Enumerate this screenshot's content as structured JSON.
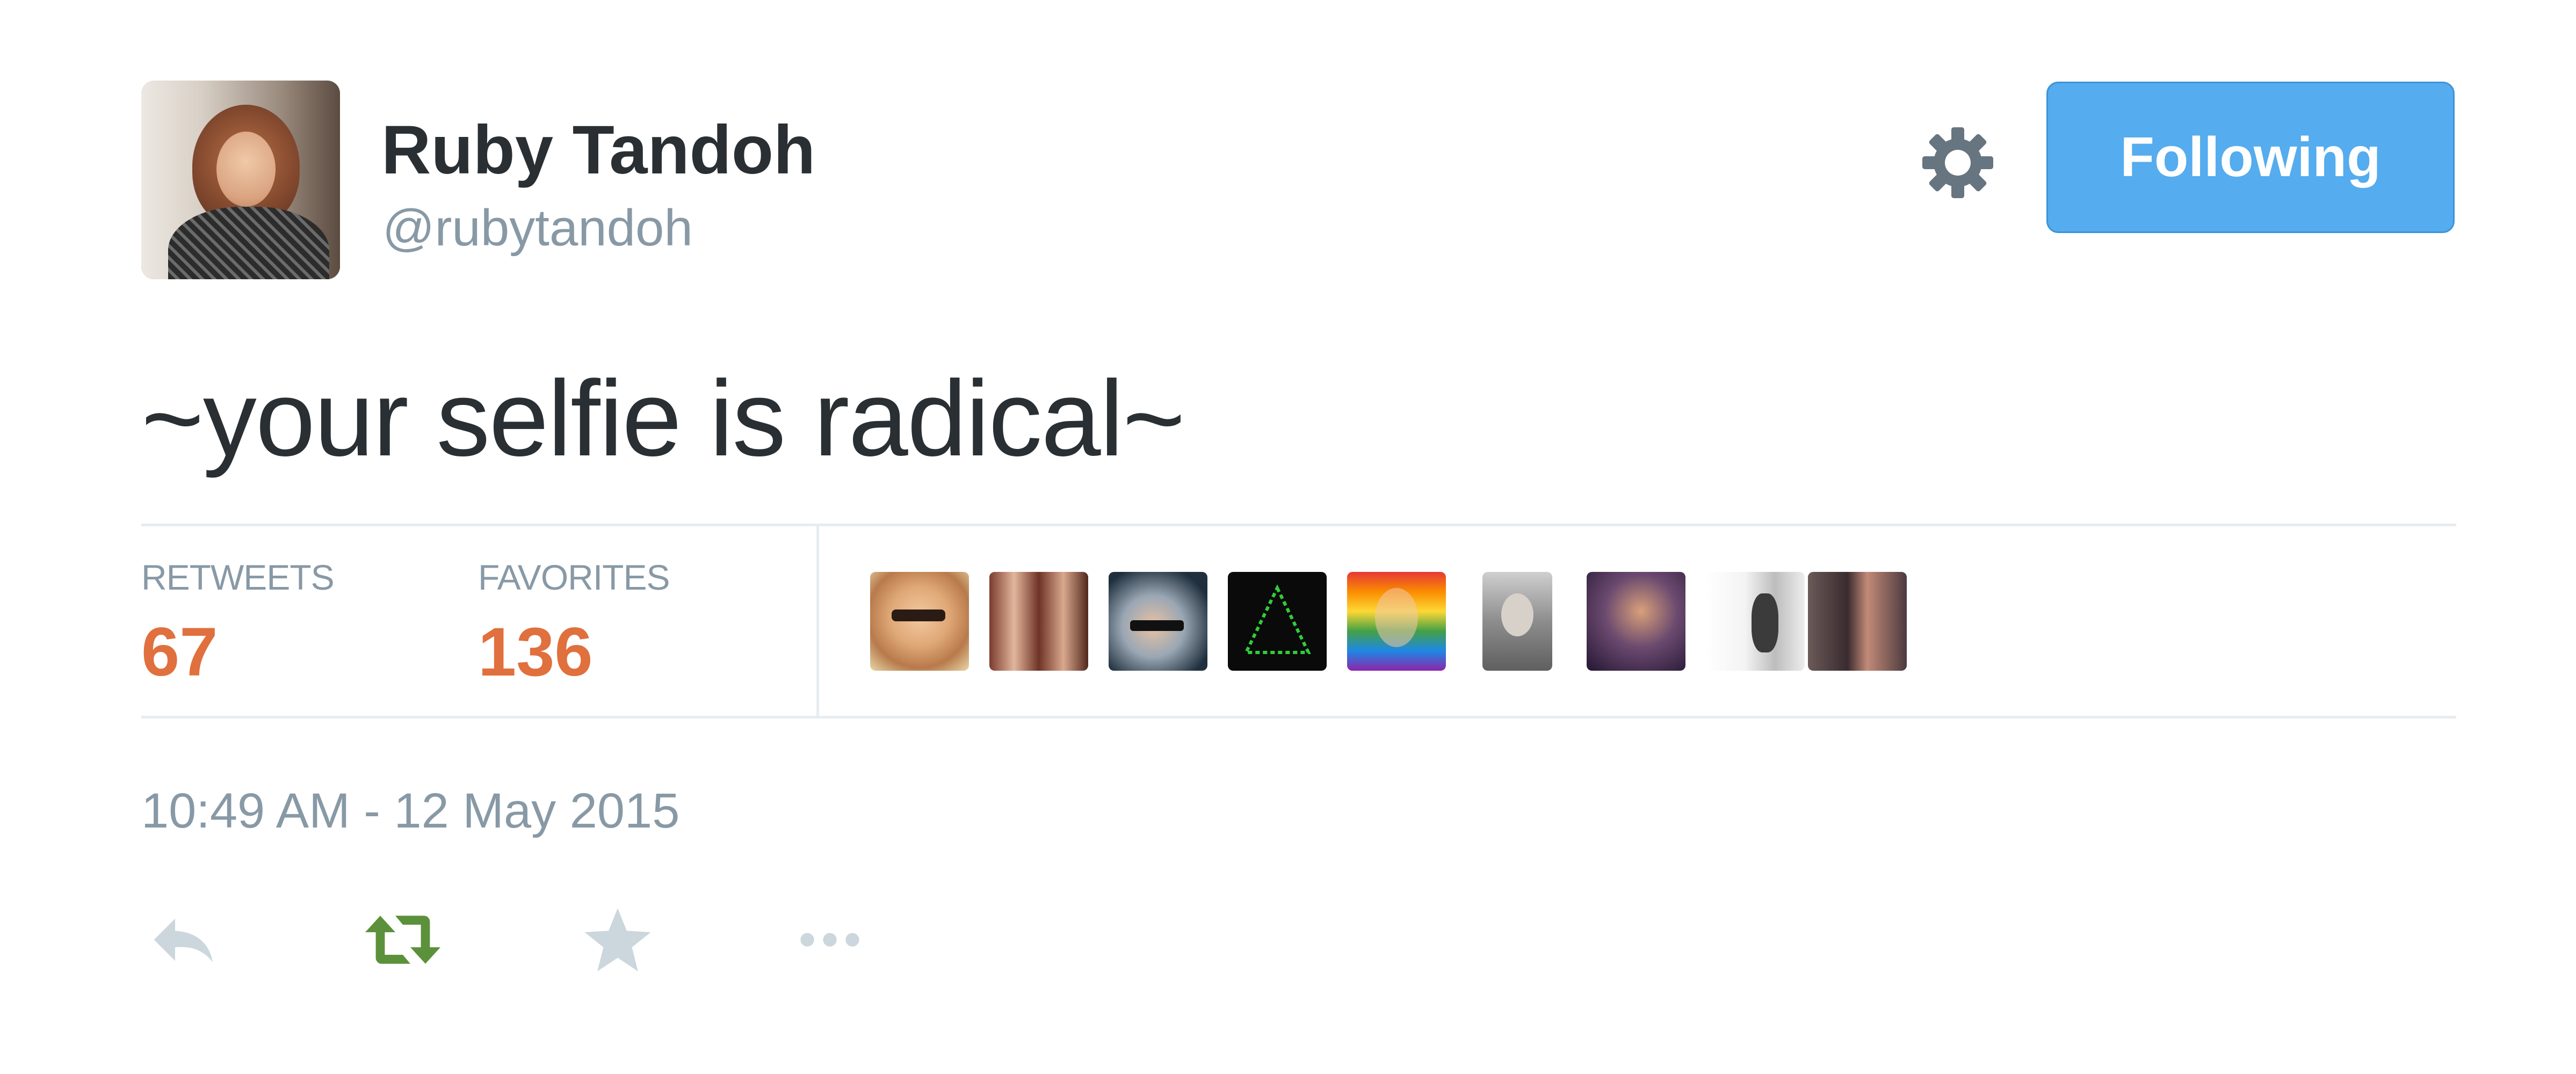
{
  "tweet": {
    "author_name": "Ruby Tandoh",
    "author_handle": "@rubytandoh",
    "follow_button_label": "Following",
    "settings_icon": "gear-icon",
    "text": "~your selfie is radical~",
    "stats": {
      "retweets_label": "RETWEETS",
      "retweets_count": "67",
      "favorites_label": "FAVORITES",
      "favorites_count": "136"
    },
    "timestamp": "10:49 AM - 12 May 2015",
    "actions": {
      "reply_icon": "reply-icon",
      "retweet_icon": "retweet-icon",
      "favorite_icon": "star-icon",
      "more_icon": "more-dots-icon"
    }
  },
  "colors": {
    "follow_button": "#55acee",
    "stat_value": "#e0703d",
    "muted_text": "#8899a6",
    "retweet_action": "#5c913b",
    "divider": "#e6ecf0"
  }
}
